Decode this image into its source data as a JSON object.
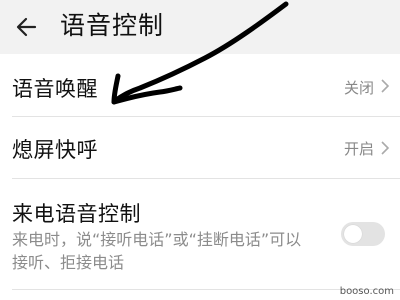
{
  "header": {
    "title": "语音控制",
    "back_icon": "arrow-left-icon"
  },
  "settings": [
    {
      "label": "语音唤醒",
      "value": "关闭"
    },
    {
      "label": "熄屏快呼",
      "value": "开启"
    }
  ],
  "incoming_call": {
    "label": "来电语音控制",
    "description": "来电时，说“接听电话”或“挂断电话”可以接听、拒接电话",
    "toggle_on": false
  },
  "annotation": {
    "type": "hand-drawn-arrow",
    "color": "#000000"
  },
  "watermark": "booso.com"
}
